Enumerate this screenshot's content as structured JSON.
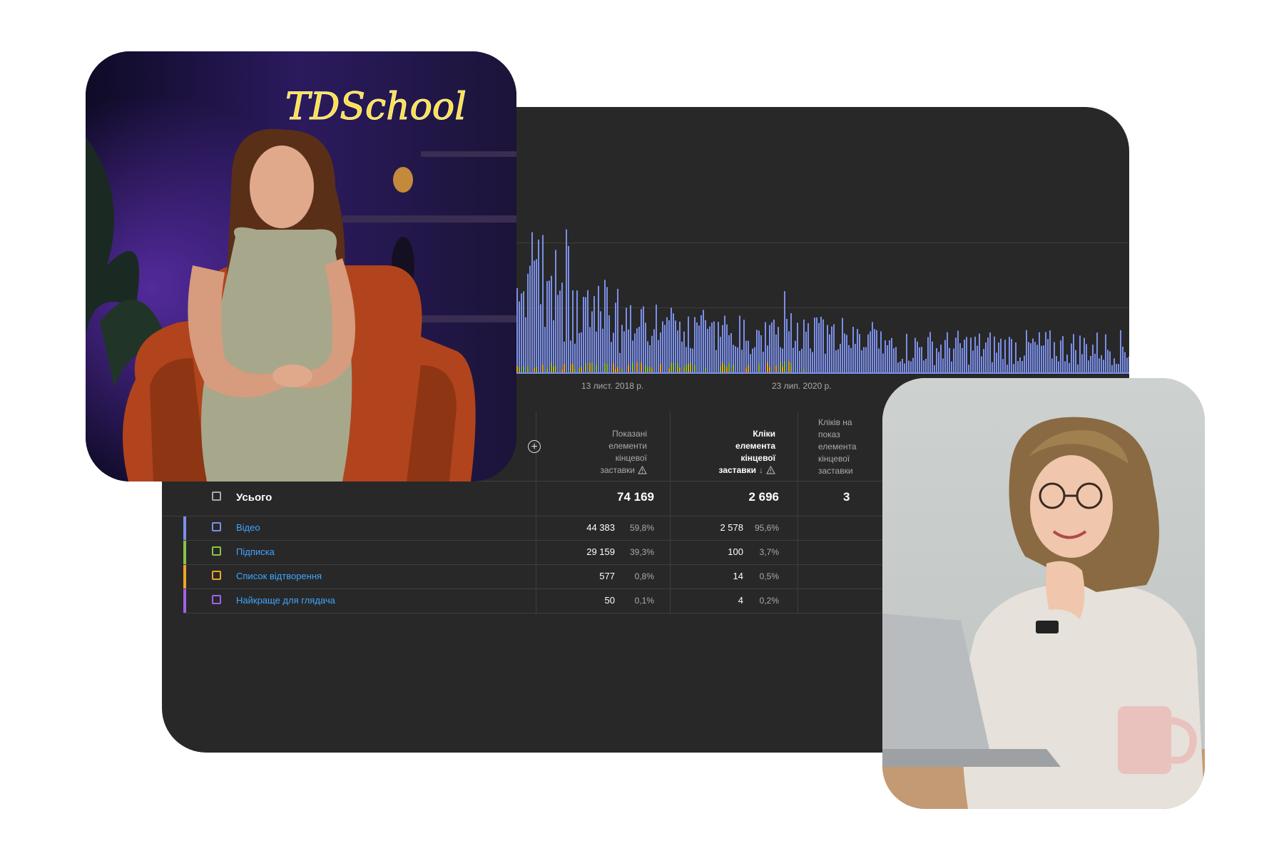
{
  "chart": {
    "date_labels": [
      "13 лист. 2018 р.",
      "23 лип. 2020 р."
    ],
    "colors": {
      "video": "#7b8fe8",
      "subscribe": "#8bc34a",
      "playlist": "#f2a526",
      "best": "#a162e8"
    }
  },
  "table": {
    "columns": [
      {
        "label": "Показані елементи кінцевої заставки",
        "bold": false
      },
      {
        "label": "Кліки елемента кінцевої заставки",
        "bold": true,
        "sorted": "↓"
      },
      {
        "label": "Кліків на показ елемента кінцевої заставки",
        "bold": false
      }
    ],
    "add_column_icon": "plus-circle-icon",
    "total": {
      "label": "Усього",
      "shown": "74 169",
      "clicks": "2 696",
      "ctr_partial": "3"
    },
    "rows": [
      {
        "label": "Відео",
        "shown": "44 383",
        "shown_pct": "59,8%",
        "clicks": "2 578",
        "clicks_pct": "95,6%",
        "color": "#7b8fe8"
      },
      {
        "label": "Підписка",
        "shown": "29 159",
        "shown_pct": "39,3%",
        "clicks": "100",
        "clicks_pct": "3,7%",
        "color": "#8bc34a"
      },
      {
        "label": "Список відтворення",
        "shown": "577",
        "shown_pct": "0,8%",
        "clicks": "14",
        "clicks_pct": "0,5%",
        "color": "#f2a526"
      },
      {
        "label": "Найкраще для глядача",
        "shown": "50",
        "shown_pct": "0,1%",
        "clicks": "4",
        "clicks_pct": "0,2%",
        "color": "#a162e8"
      }
    ]
  },
  "photos": {
    "left": {
      "sign_text": "TDSchool"
    }
  }
}
